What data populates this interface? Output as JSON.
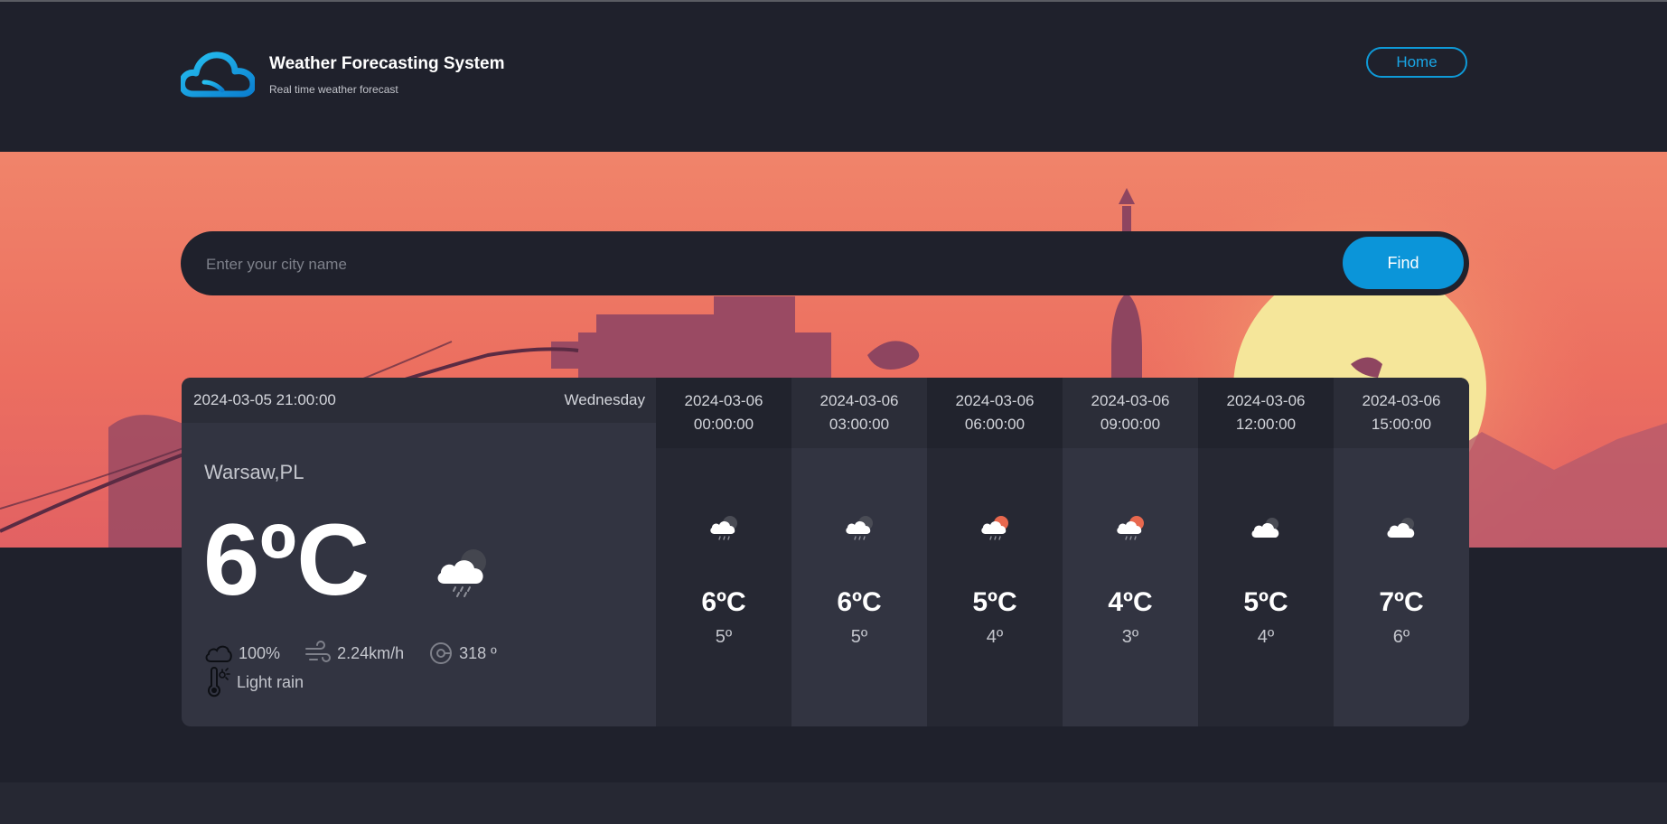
{
  "colors": {
    "accent": "#0b95d9",
    "page_background": "#1f212c",
    "hero_sky": "#ee7a62",
    "sun": "#f5e69a"
  },
  "header": {
    "title": "Weather Forecasting System",
    "subtitle": "Real time weather forecast",
    "logo_icon": "cloud-logo-icon",
    "home_label": "Home"
  },
  "search": {
    "placeholder": "Enter your city name",
    "value": "",
    "button_label": "Find"
  },
  "today": {
    "datetime": "2024-03-05 21:00:00",
    "weekday": "Wednesday",
    "location": "Warsaw,PL",
    "temperature": "6ºC",
    "icon": "cloud-rain-icon",
    "clouds": "100%",
    "wind_speed": "2.24km/h",
    "wind_direction": "318 º",
    "description": "Light rain"
  },
  "forecast": [
    {
      "date": "2024-03-06",
      "time": "00:00:00",
      "icon": "cloud-rain-icon",
      "temp": "6ºC",
      "low": "5º"
    },
    {
      "date": "2024-03-06",
      "time": "03:00:00",
      "icon": "cloud-rain-icon",
      "temp": "6ºC",
      "low": "5º"
    },
    {
      "date": "2024-03-06",
      "time": "06:00:00",
      "icon": "sun-cloud-rain-icon",
      "temp": "5ºC",
      "low": "4º"
    },
    {
      "date": "2024-03-06",
      "time": "09:00:00",
      "icon": "sun-cloud-rain-icon",
      "temp": "4ºC",
      "low": "3º"
    },
    {
      "date": "2024-03-06",
      "time": "12:00:00",
      "icon": "cloud-icon",
      "temp": "5ºC",
      "low": "4º"
    },
    {
      "date": "2024-03-06",
      "time": "15:00:00",
      "icon": "cloud-icon",
      "temp": "7ºC",
      "low": "6º"
    }
  ]
}
